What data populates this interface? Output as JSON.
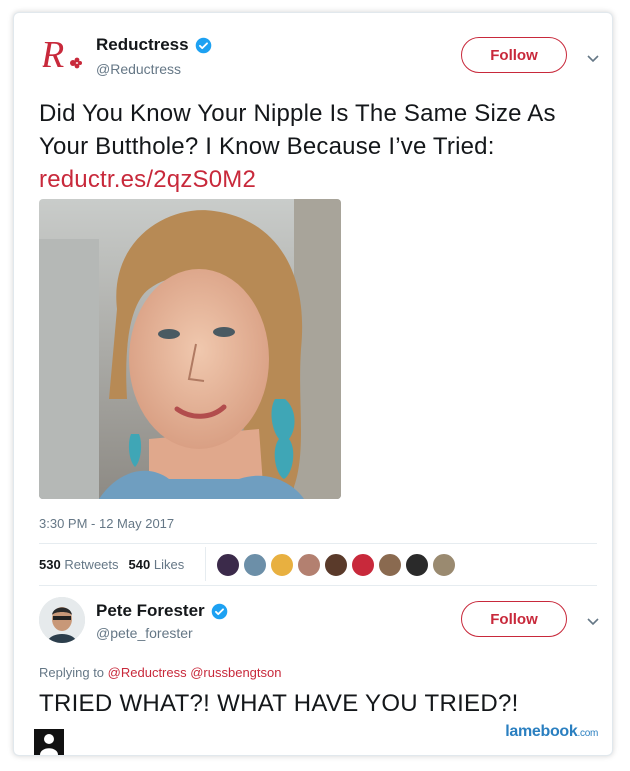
{
  "tweet": {
    "author_name": "Reductress",
    "author_handle": "@Reductress",
    "follow_label": "Follow",
    "text": "Did You Know Your Nipple Is The Same Size As Your Butthole? I Know Because I’ve Tried:",
    "link": "reductr.es/2qzS0M2",
    "timestamp": "3:30 PM - 12 May 2017",
    "retweets_count": "530",
    "retweets_label": "Retweets",
    "likes_count": "540",
    "likes_label": "Likes",
    "likers": [
      "#3b2a4a",
      "#6c8fa8",
      "#e8b040",
      "#b38070",
      "#5a3a2a",
      "#c8293b",
      "#8a6a50",
      "#2a2a2a",
      "#9a8a70"
    ]
  },
  "reply": {
    "author_name": "Pete Forester",
    "author_handle": "@pete_forester",
    "follow_label": "Follow",
    "replying_prefix": "Replying to",
    "replying_to": "@Reductress @russbengtson",
    "text": "TRIED WHAT?! WHAT HAVE YOU TRIED?!"
  },
  "watermark": {
    "main": "lamebook",
    "suffix": ".com"
  },
  "colors": {
    "accent": "#c8293b",
    "verified": "#1da1f2",
    "muted": "#657786"
  }
}
